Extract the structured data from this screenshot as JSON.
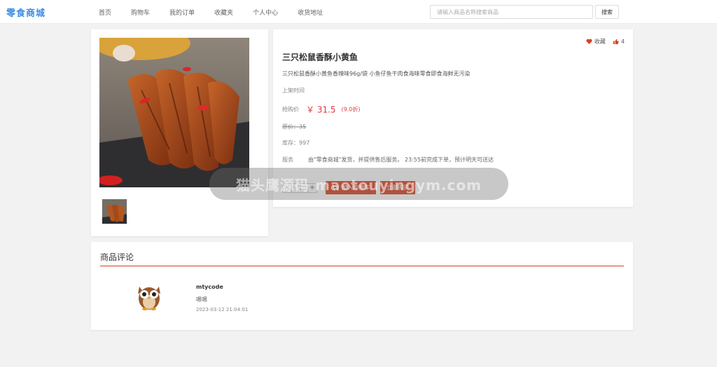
{
  "header": {
    "brand": "零食商城",
    "nav": [
      "首页",
      "购物车",
      "我的订单",
      "收藏夹",
      "个人中心",
      "收货地址"
    ],
    "search_placeholder": "请输入商品名称搜索商品",
    "search_button": "搜索"
  },
  "product": {
    "title": "三只松鼠香酥小黄鱼",
    "description": "三只松鼠香酥小黄鱼香辣味96g/袋 小鱼仔鱼干肉食海味零食即食海鲜无污染",
    "listed_label": "上架时间",
    "price_label": "抢购价",
    "price": "￥ 31.5",
    "discount": "(9.0折)",
    "original_price": "原价：35",
    "stock": "库存：997",
    "service_label": "服务",
    "service_text": "由\"零食商城\"发货，并提供售后服务。 23:55前完成下单，预计明天可送达",
    "quantity": "1",
    "minus": "-",
    "plus": "+",
    "add_to_cart": "加入购物车",
    "buy_now": "立即购买",
    "favorite_label": "收藏",
    "like_count": "4"
  },
  "reviews": {
    "title": "商品评论",
    "items": [
      {
        "user": "mtycode",
        "content": "嗯嗯",
        "time": "2023-03-12 21:04:01"
      }
    ]
  },
  "watermark": "猫头鹰源码 maotouyingym.com",
  "colors": {
    "brand": "#3a8ee6",
    "accent": "#d9401f",
    "price": "#e4393c"
  }
}
